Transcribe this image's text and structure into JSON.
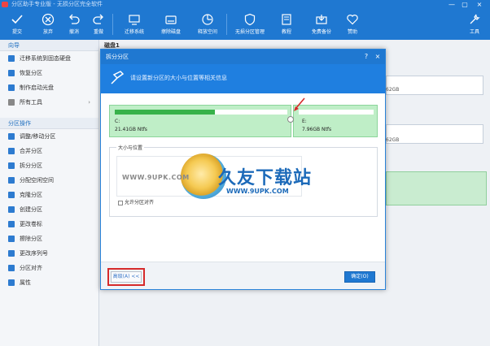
{
  "window": {
    "title": "分区助手专业版 - 无损分区完全软件"
  },
  "toolbar": {
    "items": [
      {
        "label": "提交",
        "icon": "check-icon"
      },
      {
        "label": "放弃",
        "icon": "cancel-icon"
      },
      {
        "label": "撤消",
        "icon": "undo-icon"
      },
      {
        "label": "重做",
        "icon": "redo-icon"
      },
      {
        "label": "迁移系统",
        "icon": "migrate-os-icon"
      },
      {
        "label": "擦除磁盘",
        "icon": "wipe-disk-icon"
      },
      {
        "label": "释放空间",
        "icon": "free-space-icon"
      },
      {
        "label": "无损分区管理",
        "icon": "shield-icon"
      },
      {
        "label": "教程",
        "icon": "tutorial-icon"
      },
      {
        "label": "免费备份",
        "icon": "backup-icon"
      },
      {
        "label": "赞助",
        "icon": "heart-icon"
      },
      {
        "label": "工具",
        "icon": "tools-icon"
      }
    ]
  },
  "sidebar": {
    "wizard_title": "向导",
    "wizard_items": [
      "迁移系统到固态硬盘",
      "恢复分区",
      "制作启动光盘",
      "所有工具"
    ],
    "ops_title": "分区操作",
    "ops_items": [
      "调整/移动分区",
      "合并分区",
      "拆分分区",
      "分配空闲空间",
      "克隆分区",
      "创建分区",
      "更改卷标",
      "擦除分区",
      "更改序列号",
      "分区对齐",
      "属性"
    ]
  },
  "main": {
    "disk_label": "磁盘1",
    "size_a": "62GB",
    "size_b": "62GB"
  },
  "dialog": {
    "title": "拆分分区",
    "header_msg": "请设置新分区的大小与位置等相关信息",
    "left_part": {
      "letter": "C:",
      "info": "21.41GB Ntfs",
      "fill": 0.58
    },
    "right_part": {
      "letter": "E:",
      "info": "7.96GB Ntfs"
    },
    "group_title": "大小与位置",
    "checkbox_label": "允许分区对齐",
    "less_button": "高级(A) <<",
    "ok_button": "确定(O)"
  },
  "watermark": {
    "url_left": "WWW.9UPK.COM",
    "brand": "久友下载站",
    "url_right": "WWW.9UPK.COM"
  },
  "colors": {
    "accent": "#1f78d1",
    "partition_green": "#bfeec7",
    "bar_green": "#38b24a",
    "highlight_red": "#d62a2a"
  }
}
